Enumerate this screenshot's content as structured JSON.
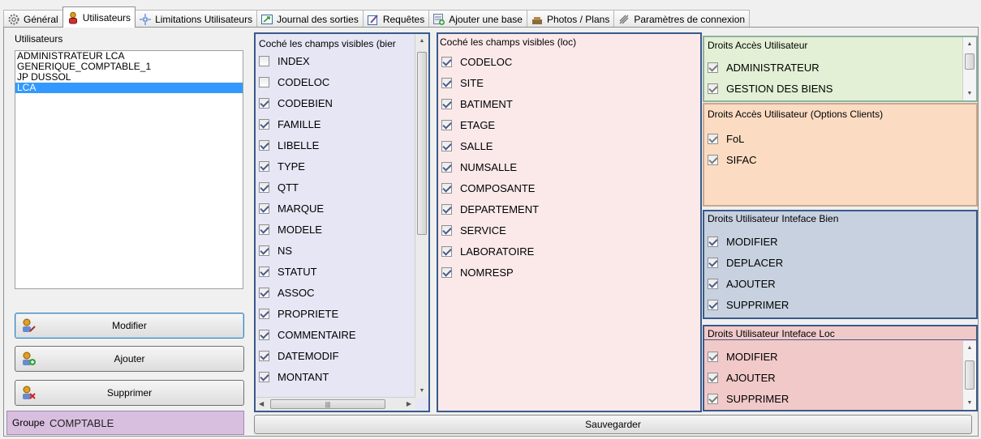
{
  "tabs": [
    {
      "label": "Général",
      "icon": "gear-icon"
    },
    {
      "label": "Utilisateurs",
      "icon": "user-icon"
    },
    {
      "label": "Limitations Utilisateurs",
      "icon": "limits-icon"
    },
    {
      "label": "Journal des sorties",
      "icon": "exit-log-icon"
    },
    {
      "label": "Requêtes",
      "icon": "query-icon"
    },
    {
      "label": "Ajouter une base",
      "icon": "add-database-icon"
    },
    {
      "label": "Photos / Plans",
      "icon": "photo-icon"
    },
    {
      "label": "Paramètres de connexion",
      "icon": "connection-settings-icon"
    }
  ],
  "active_tab": "Utilisateurs",
  "users": {
    "title": "Utilisateurs",
    "items": [
      "ADMINISTRATEUR LCA",
      "GENERIQUE_COMPTABLE_1",
      "JP DUSSOL",
      "LCA"
    ],
    "selected": "LCA",
    "buttons": {
      "modifier": "Modifier",
      "ajouter": "Ajouter",
      "supprimer": "Supprimer"
    },
    "groupe_label": "Groupe",
    "groupe_value": "COMPTABLE"
  },
  "bien": {
    "title": "Coché les champs visibles (bier",
    "fields": [
      {
        "label": "INDEX",
        "checked": false
      },
      {
        "label": "CODELOC",
        "checked": false
      },
      {
        "label": "CODEBIEN",
        "checked": true
      },
      {
        "label": "FAMILLE",
        "checked": true
      },
      {
        "label": "LIBELLE",
        "checked": true
      },
      {
        "label": "TYPE",
        "checked": true
      },
      {
        "label": "QTT",
        "checked": true
      },
      {
        "label": "MARQUE",
        "checked": true
      },
      {
        "label": "MODELE",
        "checked": true
      },
      {
        "label": "NS",
        "checked": true
      },
      {
        "label": "STATUT",
        "checked": true
      },
      {
        "label": "ASSOC",
        "checked": true
      },
      {
        "label": "PROPRIETE",
        "checked": true
      },
      {
        "label": "COMMENTAIRE",
        "checked": true
      },
      {
        "label": "DATEMODIF",
        "checked": true
      },
      {
        "label": "MONTANT",
        "checked": true
      }
    ]
  },
  "loc": {
    "title": "Coché les champs visibles (loc)",
    "fields": [
      {
        "label": "CODELOC",
        "checked": true
      },
      {
        "label": "SITE",
        "checked": true
      },
      {
        "label": "BATIMENT",
        "checked": true
      },
      {
        "label": "ETAGE",
        "checked": true
      },
      {
        "label": "SALLE",
        "checked": true
      },
      {
        "label": "NUMSALLE",
        "checked": true
      },
      {
        "label": "COMPOSANTE",
        "checked": true
      },
      {
        "label": "DEPARTEMENT",
        "checked": true
      },
      {
        "label": "SERVICE",
        "checked": true
      },
      {
        "label": "LABORATOIRE",
        "checked": true
      },
      {
        "label": "NOMRESP",
        "checked": true
      }
    ]
  },
  "droits_acces": {
    "title": "Droits Accès Utilisateur",
    "items": [
      {
        "label": "ADMINISTRATEUR",
        "checked": true
      },
      {
        "label": "GESTION DES BIENS",
        "checked": true
      }
    ]
  },
  "droits_options": {
    "title": "Droits Accès Utilisateur (Options Clients)",
    "items": [
      {
        "label": "FoL",
        "checked": true
      },
      {
        "label": "SIFAC",
        "checked": true
      }
    ]
  },
  "droits_bien": {
    "title": "Droits Utilisateur Inteface Bien",
    "items": [
      {
        "label": "MODIFIER",
        "checked": true
      },
      {
        "label": "DEPLACER",
        "checked": true
      },
      {
        "label": "AJOUTER",
        "checked": true
      },
      {
        "label": "SUPPRIMER",
        "checked": true
      }
    ]
  },
  "droits_loc": {
    "title": "Droits Utilisateur Inteface Loc",
    "items": [
      {
        "label": "MODIFIER",
        "checked": true
      },
      {
        "label": "AJOUTER",
        "checked": true
      },
      {
        "label": "SUPPRIMER",
        "checked": true
      }
    ]
  },
  "save_label": "Sauvegarder"
}
